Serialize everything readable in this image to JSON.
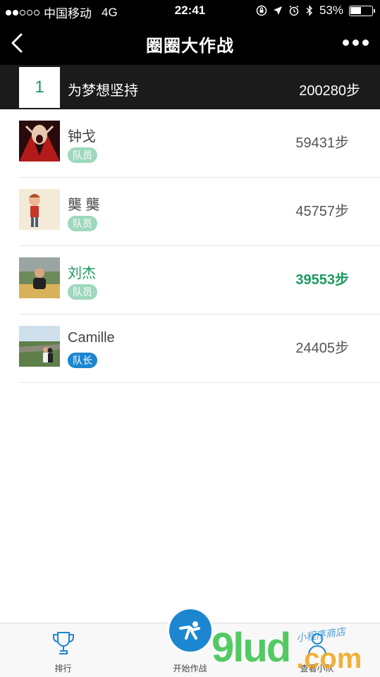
{
  "status_bar": {
    "carrier": "中国移动",
    "network": "4G",
    "time": "22:41",
    "battery_text": "53%",
    "battery_level": 0.53
  },
  "nav": {
    "title": "圈圈大作战",
    "back_icon": "chevron-left-icon",
    "more_icon": "more-dots-icon"
  },
  "team": {
    "rank": "1",
    "name": "为梦想坚持",
    "steps": "200280步"
  },
  "members": [
    {
      "name": "钟戈",
      "role": "队员",
      "steps": "59431步",
      "highlight": false
    },
    {
      "name": "龑 龑",
      "role": "队员",
      "steps": "45757步",
      "highlight": false
    },
    {
      "name": "刘杰",
      "role": "队员",
      "steps": "39553步",
      "highlight": true
    },
    {
      "name": "Camille",
      "role": "队长",
      "steps": "24405步",
      "highlight": false
    }
  ],
  "tabbar": {
    "ranking_label": "排行",
    "start_label": "开始作战",
    "team_label": "查看小队"
  },
  "watermark": {
    "main": "9lud",
    "suffix": ".com",
    "sub": "小程序商店"
  },
  "colors": {
    "accent_green": "#1a9b5e",
    "badge_member": "#9ed8bd",
    "badge_captain": "#1c86d1",
    "header_bg": "#000000"
  }
}
